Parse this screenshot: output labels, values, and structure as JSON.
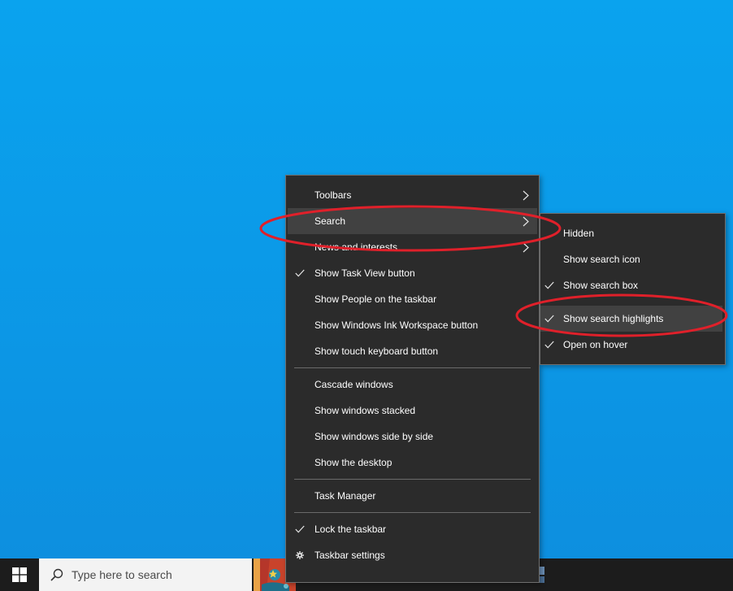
{
  "taskbar": {
    "search_placeholder": "Type here to search"
  },
  "main_menu": {
    "items": [
      {
        "label": "Toolbars",
        "checked": false,
        "submenu": true
      },
      {
        "label": "Search",
        "checked": false,
        "submenu": true,
        "highlighted": true
      },
      {
        "label": "News and interests",
        "checked": false,
        "submenu": true
      },
      {
        "label": "Show Task View button",
        "checked": true
      },
      {
        "label": "Show People on the taskbar",
        "checked": false
      },
      {
        "label": "Show Windows Ink Workspace button",
        "checked": false
      },
      {
        "label": "Show touch keyboard button",
        "checked": false
      },
      {
        "label": "Cascade windows",
        "checked": false
      },
      {
        "label": "Show windows stacked",
        "checked": false
      },
      {
        "label": "Show windows side by side",
        "checked": false
      },
      {
        "label": "Show the desktop",
        "checked": false
      },
      {
        "label": "Task Manager",
        "checked": false
      },
      {
        "label": "Lock the taskbar",
        "checked": true
      },
      {
        "label": "Taskbar settings",
        "icon": "gear-icon"
      }
    ]
  },
  "search_submenu": {
    "items": [
      {
        "label": "Hidden",
        "checked": false
      },
      {
        "label": "Show search icon",
        "checked": false
      },
      {
        "label": "Show search box",
        "checked": true
      },
      {
        "label": "Show search highlights",
        "checked": true,
        "highlighted": true
      },
      {
        "label": "Open on hover",
        "checked": true
      }
    ]
  },
  "colors": {
    "desktop": "#0b9ae8",
    "menu_bg": "#2b2b2b",
    "menu_hover": "#414141",
    "annotation": "#e0202a"
  }
}
